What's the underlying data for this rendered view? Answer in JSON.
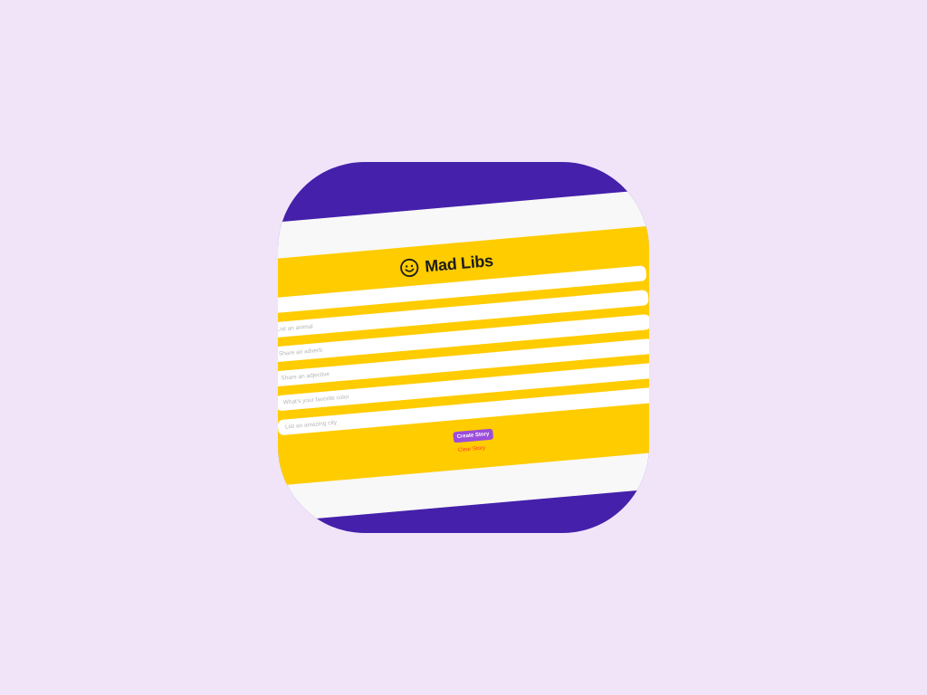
{
  "app": {
    "title": "Mad Libs",
    "icon": "smiley-face-icon"
  },
  "form": {
    "fields": [
      {
        "placeholder": "",
        "value": ""
      },
      {
        "placeholder": "List an animal",
        "value": ""
      },
      {
        "placeholder": "Share an adverb",
        "value": ""
      },
      {
        "placeholder": "Share an adjective",
        "value": ""
      },
      {
        "placeholder": "What's your favorite color",
        "value": ""
      },
      {
        "placeholder": "List an amazing city",
        "value": ""
      }
    ],
    "create_button": "Create Story",
    "clear_button": "Clear Story"
  },
  "colors": {
    "background": "#f1e4f8",
    "icon_purple": "#4520ab",
    "panel_yellow": "#ffcc00",
    "button_purple": "#9b4ddb",
    "clear_red": "#ff3b30"
  }
}
